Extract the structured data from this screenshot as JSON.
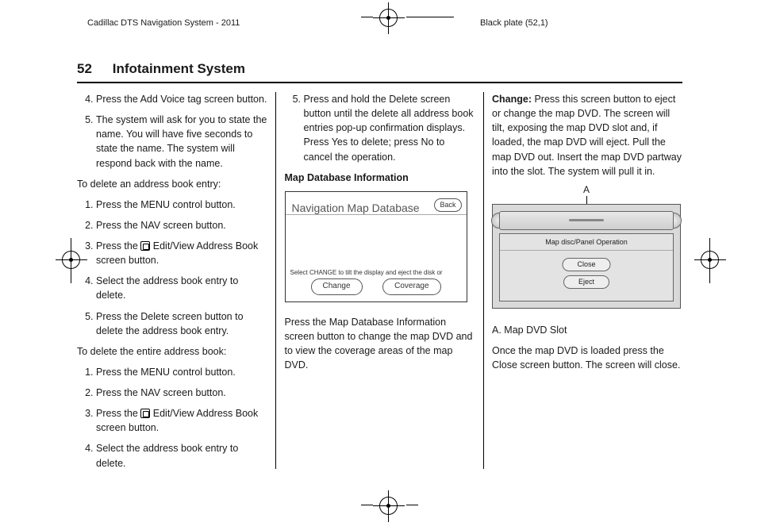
{
  "meta": {
    "doc_title": "Cadillac DTS Navigation System - 2011",
    "plate": "Black plate (52,1)"
  },
  "header": {
    "page_number": "52",
    "section_title": "Infotainment System"
  },
  "col1": {
    "list_a_start": 4,
    "list_a": [
      "Press the Add Voice tag screen button.",
      "The system will ask for you to state the name. You will have five seconds to state the name. The system will respond back with the name."
    ],
    "para1": "To delete an address book entry:",
    "list_b": [
      "Press the MENU control button.",
      "Press the NAV screen button.",
      {
        "pre": "Press the ",
        "post": " Edit/View Address Book screen button.",
        "icon": "address-book-icon"
      },
      "Select the address book entry to delete.",
      "Press the Delete screen button to delete the address book entry."
    ],
    "para2": "To delete the entire address book:",
    "list_c": [
      "Press the MENU control button.",
      "Press the NAV screen button.",
      {
        "pre": "Press the ",
        "post": " Edit/View Address Book screen button.",
        "icon": "address-book-icon"
      },
      "Select the address book entry to delete."
    ]
  },
  "col2": {
    "list_a_start": 5,
    "list_a": [
      "Press and hold the Delete screen button until the delete all address book entries pop-up confirmation displays. Press Yes to delete; press No to cancel the operation."
    ],
    "subhead": "Map Database Information",
    "fig1": {
      "title": "Navigation Map Database",
      "back": "Back",
      "caption": "Select CHANGE to tilt the display and eject the disk or",
      "btn_change": "Change",
      "btn_coverage": "Coverage"
    },
    "para_after": "Press the Map Database Information screen button to change the map DVD and to view the coverage areas of the map DVD."
  },
  "col3": {
    "change_label": "Change:",
    "change_text": "  Press this screen button to eject or change the map DVD. The screen will tilt, exposing the map DVD slot and, if loaded, the map DVD will eject. Pull the map DVD out. Insert the map DVD partway into the slot. The system will pull it in.",
    "fig2": {
      "callout": "A",
      "titlebar": "Map disc/Panel Operation",
      "btn_close": "Close",
      "btn_eject": "Eject"
    },
    "legend": "A.   Map DVD Slot",
    "para_after": "Once the map DVD is loaded press the Close screen button. The screen will close."
  }
}
